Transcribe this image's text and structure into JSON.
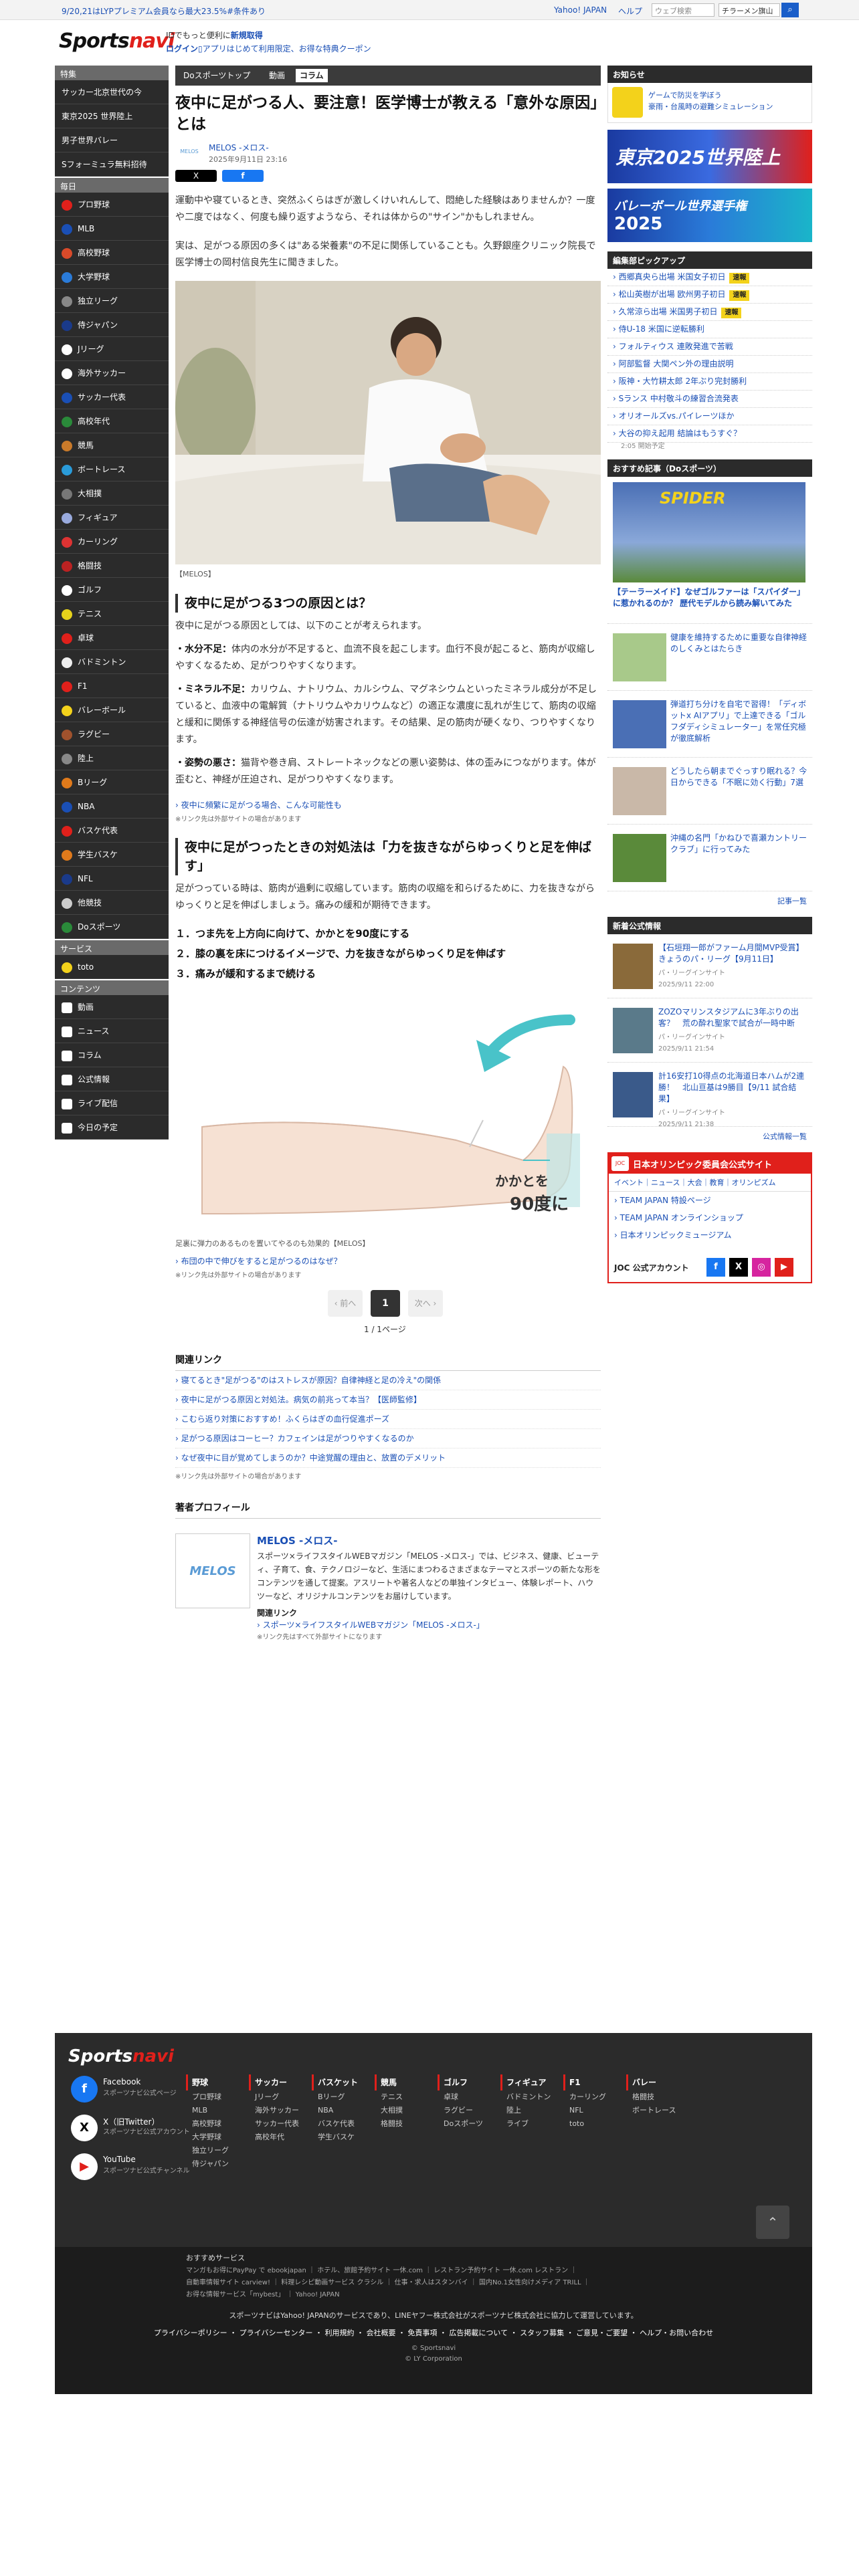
{
  "topbar": {
    "promo": "9/20,21はLYPプレミアム会員なら最大23.5%#条件あり",
    "yahoo": "Yahoo! JAPAN",
    "help": "ヘルプ",
    "search_placeholder": "ウェブ検索",
    "search_value": "チラーメン旗山",
    "search_icon": "search-icon"
  },
  "header": {
    "logo_a": "Sports",
    "logo_b": "navi",
    "id_text": "IDでもっと便利に",
    "id_link": "新規取得",
    "login": "ログイン",
    "coupon": "アプリはじめて利用限定、お得な特典クーポン"
  },
  "sidebar": {
    "tokushu_label": "特集",
    "tokushu": [
      "サッカー北京世代の今",
      "東京2025 世界陸上",
      "男子世界バレー",
      "Sフォーミュラ無料招待"
    ],
    "daily_label": "毎日",
    "sports": [
      {
        "label": "プロ野球",
        "color": "#e0201b"
      },
      {
        "label": "MLB",
        "color": "#1a4fb5"
      },
      {
        "label": "高校野球",
        "color": "#d94a2a"
      },
      {
        "label": "大学野球",
        "color": "#2a7bd9"
      },
      {
        "label": "独立リーグ",
        "color": "#888"
      },
      {
        "label": "侍ジャパン",
        "color": "#1a3a8a"
      },
      {
        "label": "Jリーグ",
        "color": "#fff"
      },
      {
        "label": "海外サッカー",
        "color": "#fff"
      },
      {
        "label": "サッカー代表",
        "color": "#1a4fb5"
      },
      {
        "label": "高校年代",
        "color": "#2a8a3a"
      },
      {
        "label": "競馬",
        "color": "#c97a2a"
      },
      {
        "label": "ボートレース",
        "color": "#2a9bd9"
      },
      {
        "label": "大相撲",
        "color": "#777"
      },
      {
        "label": "フィギュア",
        "color": "#9ad"
      },
      {
        "label": "カーリング",
        "color": "#d33"
      },
      {
        "label": "格闘技",
        "color": "#b22"
      },
      {
        "label": "ゴルフ",
        "color": "#fff"
      },
      {
        "label": "テニス",
        "color": "#e6d21b"
      },
      {
        "label": "卓球",
        "color": "#e0201b"
      },
      {
        "label": "バドミントン",
        "color": "#eee"
      },
      {
        "label": "F1",
        "color": "#e0201b"
      },
      {
        "label": "バレーボール",
        "color": "#f3d21b"
      },
      {
        "label": "ラグビー",
        "color": "#a0522d"
      },
      {
        "label": "陸上",
        "color": "#888"
      },
      {
        "label": "Bリーグ",
        "color": "#e07a1b"
      },
      {
        "label": "NBA",
        "color": "#1a4fb5"
      },
      {
        "label": "バスケ代表",
        "color": "#e0201b"
      },
      {
        "label": "学生バスケ",
        "color": "#e07a1b"
      },
      {
        "label": "NFL",
        "color": "#1a3a8a"
      },
      {
        "label": "他競技",
        "color": "#ccc"
      },
      {
        "label": "Doスポーツ",
        "color": "#2a8a3a"
      }
    ],
    "service_label": "サービス",
    "services": [
      "toto"
    ],
    "content_label": "コンテンツ",
    "contents": [
      "動画",
      "ニュース",
      "コラム",
      "公式情報",
      "ライブ配信",
      "今日の予定"
    ]
  },
  "main": {
    "tabs": [
      "Doスポーツトップ",
      "動画",
      "コラム"
    ],
    "title": "夜中に足がつる人、要注意！医学博士が教える「意外な原因」とは",
    "author_logo": "MELOS",
    "author": "MELOS -メロス-",
    "date": "2025年9月11日 23:16",
    "share_x": "X",
    "share_fb": "f",
    "intro1": "運動中や寝ているとき、突然ふくらはぎが激しくけいれんして、悶絶した経験はありませんか？一度や二度ではなく、何度も繰り返すようなら、それは体からの\"サイン\"かもしれません。",
    "intro2": "実は、足がつる原因の多くは\"ある栄養素\"の不足に関係していることも。久野銀座クリニック院長で医学博士の岡村信良先生に聞きました。",
    "photo_caption": "【MELOS】",
    "h2_1": "夜中に足がつる3つの原因とは？",
    "h2_1_lead": "夜中に足がつる原因としては、以下のことが考えられます。",
    "causes": [
      {
        "head": "・水分不足：",
        "body": "体内の水分が不足すると、血流不良を起こします。血行不良が起こると、筋肉が収縮しやすくなるため、足がつりやすくなります。"
      },
      {
        "head": "・ミネラル不足：",
        "body": "カリウム、ナトリウム、カルシウム、マグネシウムといったミネラル成分が不足していると、血液中の電解質（ナトリウムやカリウムなど）の適正な濃度に乱れが生じて、筋肉の収縮と緩和に関係する神経信号の伝達が妨害されます。その結果、足の筋肉が硬くなり、つりやすくなります。"
      },
      {
        "head": "・姿勢の悪さ：",
        "body": "猫背や巻き肩、ストレートネックなどの悪い姿勢は、体の歪みにつながります。体が歪むと、神経が圧迫され、足がつりやすくなります。"
      }
    ],
    "link1": "夜中に頻繁に足がつる場合、こんな可能性も",
    "note1": "※リンク先は外部サイトの場合があります",
    "h2_2": "夜中に足がつったときの対処法は「力を抜きながらゆっくりと足を伸ばす」",
    "h2_2_lead": "足がつっている時は、筋肉が過剰に収縮しています。筋肉の収縮を和らげるために、力を抜きながらゆっくりと足を伸ばしましょう。痛みの緩和が期待できます。",
    "steps": [
      "１．つま先を上方向に向けて、かかとを90度にする",
      "２．膝の裏を床につけるイメージで、力を抜きながらゆっくり足を伸ばす",
      "３．痛みが緩和するまで続ける"
    ],
    "illust_text1": "かかとを",
    "illust_text2": "90度に",
    "illust_caption": "足裏に弾力のあるものを置いてやるのも効果的【MELOS】",
    "link2": "布団の中で伸びをすると足がつるのはなぜ？",
    "note2": "※リンク先は外部サイトの場合があります",
    "pager_prev": "‹ 前へ",
    "pager_num": "1",
    "pager_next": "次へ ›",
    "pager_count": "1 / 1ページ",
    "related_head": "関連リンク",
    "related": [
      "寝てるとき\"足がつる\"のはストレスが原因？自律神経と足の冷え\"の関係",
      "夜中に足がつる原因と対処法。病気の前兆って本当？【医師監修】",
      "こむら返り対策におすすめ！ふくらはぎの血行促進ポーズ",
      "足がつる原因はコーヒー？カフェインは足がつりやすくなるのか",
      "なぜ夜中に目が覚めてしまうのか？中途覚醒の理由と、放置のデメリット"
    ],
    "related_note": "※リンク先は外部サイトの場合があります",
    "profile_head": "著者プロフィール",
    "profile_logo": "MELOS",
    "profile_name": "MELOS -メロス-",
    "profile_desc": "スポーツ×ライフスタイルWEBマガジン「MELOS -メロス-」では、ビジネス、健康、ビューティ、子育て、食、テクノロジーなど、生活にまつわるさまざまなテーマとスポーツの新たな形をコンテンツを通して提案。アスリートや著名人などの単独インタビュー、体験レポート、ハウツーなど、オリジナルコンテンツをお届けしています。",
    "profile_rel_head": "関連リンク",
    "profile_rel": "スポーツ×ライフスタイルWEBマガジン「MELOS -メロス-」",
    "profile_rel_note": "※リンク先はすべて外部サイトになります"
  },
  "right": {
    "oshirase": "お知らせ",
    "oshirase_text": "ゲームで防災を学ぼう\n豪雨・台風時の避難シミュレーション",
    "ad1": "東京2025世界陸上",
    "ad2_a": "バレーボール世界選手権",
    "ad2_b": "2025",
    "pickup_head": "編集部ピックアップ",
    "pickup": [
      {
        "label": "西郷真央ら出場 米国女子初日",
        "badge": "速報"
      },
      {
        "label": "松山英樹が出場 欧州男子初日",
        "badge": "速報"
      },
      {
        "label": "久常涼ら出場 米国男子初日",
        "badge": "速報"
      },
      {
        "label": "侍U-18 米国に逆転勝利",
        "badge": ""
      },
      {
        "label": "フォルティウス 連敗発進で苦戦",
        "badge": ""
      },
      {
        "label": "阿部監督 大関ペン外の理由説明",
        "badge": ""
      },
      {
        "label": "阪神・大竹耕太郎 2年ぶり完封勝利",
        "badge": ""
      },
      {
        "label": "Sランス 中村敬斗の練習合流発表",
        "badge": ""
      },
      {
        "label": "オリオールズvs.パイレーツほか",
        "badge": ""
      },
      {
        "label": "大谷の抑え起用 結論はもうすぐ？",
        "badge": ""
      }
    ],
    "pickup_sub": "2:05 開始予定",
    "osusume_head": "おすすめ記事（Doスポーツ）",
    "osusume_main": "【テーラーメイド】なぜゴルファーは「スパイダー」に惹かれるのか？ 歴代モデルから読み解いてみた",
    "osusume_main_sign": "SPIDER",
    "osusume": [
      {
        "title": "健康を維持するために重要な自律神経のしくみとはたらき"
      },
      {
        "title": "弾道打ち分けを自宅で習得！「ディボットx AIアプリ」で上達できる「ゴルフダディシミュレーター」を常任究極が徹底解析"
      },
      {
        "title": "どうしたら朝までぐっすり眠れる？今日からできる「不眠に効く行動」7選"
      },
      {
        "title": "沖縄の名門「かねひで喜瀬カントリークラブ」に行ってみた"
      }
    ],
    "osusume_more": "記事一覧",
    "shinchaku_head": "新着公式情報",
    "shinchaku": [
      {
        "title": "【石垣翔一郎がファーム月間MVP受賞】きょうのパ・リーグ【9月11日】",
        "src": "パ・リーグインサイト",
        "date": "2025/9/11 22:00"
      },
      {
        "title": "ZOZOマリンスタジアムに3年ぶりの出客？　荒の酔れ聖家で試合が一時中断",
        "src": "パ・リーグインサイト",
        "date": "2025/9/11 21:54"
      },
      {
        "title": "計16安打10得点の北海道日本ハムが2連勝！　北山亘基は9勝目【9/11 試合結果】",
        "src": "パ・リーグインサイト",
        "date": "2025/9/11 21:38"
      }
    ],
    "shinchaku_more": "公式情報一覧",
    "joc_head": "日本オリンピック委員会公式サイト",
    "joc_tabs": "イベント｜ニュース｜大会｜教育｜オリンピズム",
    "joc_links": [
      "TEAM JAPAN 特設ページ",
      "TEAM JAPAN オンラインショップ",
      "日本オリンピックミュージアム"
    ],
    "joc_acc": "JOC 公式アカウント"
  },
  "footer": {
    "logo_a": "Sports",
    "logo_b": "navi",
    "sns": [
      {
        "name": "Facebook",
        "sub": "スポーツナビ公式ページ",
        "color": "#1877f2",
        "glyph": "f"
      },
      {
        "name": "X（旧Twitter）",
        "sub": "スポーツナビ公式アカウント",
        "color": "#fff",
        "glyph": "X"
      },
      {
        "name": "YouTube",
        "sub": "スポーツナビ公式チャンネル",
        "color": "#fff",
        "glyph": "▶"
      }
    ],
    "col1": [
      "野球",
      "プロ野球",
      "MLB",
      "高校野球",
      "大学野球",
      "独立リーグ",
      "侍ジャパン"
    ],
    "col2": [
      "サッカー",
      "Jリーグ",
      "海外サッカー",
      "サッカー代表",
      "高校年代"
    ],
    "col3": [
      "バスケット",
      "Bリーグ",
      "NBA",
      "バスケ代表",
      "学生バスケ"
    ],
    "col4": [
      "競馬",
      "テニス",
      "大相撲",
      "格闘技"
    ],
    "col5": [
      "ゴルフ",
      "卓球",
      "ラグビー",
      "Doスポーツ"
    ],
    "col6": [
      "フィギュア",
      "バドミントン",
      "陸上",
      "ライブ"
    ],
    "col7": [
      "F1",
      "カーリング",
      "NFL",
      "toto"
    ],
    "col8": [
      "バレー",
      "格闘技",
      "ボートレース"
    ],
    "rec_head": "おすすめサービス",
    "rec1": "マンガもお得にPayPay で ebookjapan ｜ ホテル、旅館予約サイト 一休.com ｜ レストラン予約サイト 一休.com レストラン ｜",
    "rec2": "自動車情報サイト carview! ｜ 料理レシピ動画サービス クラシル ｜ 仕事・求人はスタンバイ ｜ 国内No.1女性向けメディア TRILL ｜",
    "rec3": "お得な情報サービス「mybest」 ｜ Yahoo! JAPAN",
    "service_note": "スポーツナビはYahoo! JAPANのサービスであり、LINEヤフー株式会社がスポーツナビ株式会社に協力して運営しています。",
    "links": "プライバシーポリシー ・ プライバシーセンター ・ 利用規約 ・ 会社概要 ・ 免責事項 ・ 広告掲載について ・ スタッフ募集 ・ ご意見・ご要望 ・ ヘルプ・お問い合わせ",
    "copy1": "© Sportsnavi",
    "copy2": "© LY Corporation"
  }
}
